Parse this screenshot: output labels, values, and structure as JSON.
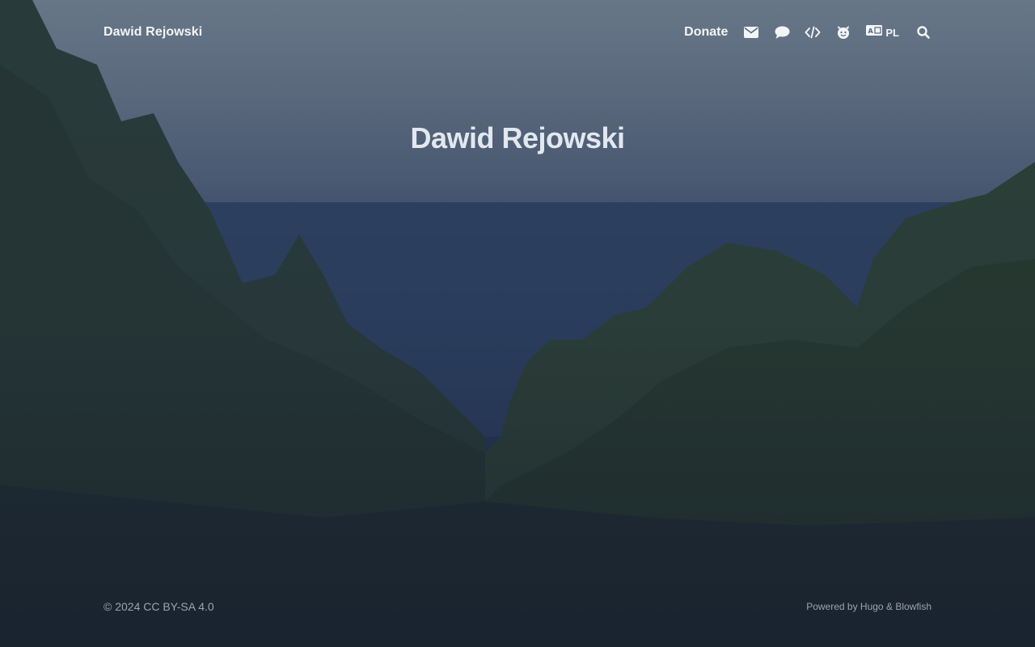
{
  "header": {
    "site_title": "Dawid Rejowski",
    "nav": {
      "donate_label": "Donate",
      "icons": [
        "envelope-icon",
        "chat-icon",
        "code-icon",
        "mascot-icon",
        "language-icon",
        "search-icon"
      ],
      "language_label": "PL"
    }
  },
  "hero": {
    "title": "Dawid Rejowski"
  },
  "footer": {
    "copyright": "© 2024 CC BY-SA 4.0",
    "powered_prefix": "Powered by",
    "powered_hugo": "Hugo",
    "powered_amp": "&",
    "powered_blowfish": "Blowfish"
  },
  "colors": {
    "text": "#f3f4f6",
    "muted": "#9ca3af",
    "hero": "#e2e8f0"
  }
}
